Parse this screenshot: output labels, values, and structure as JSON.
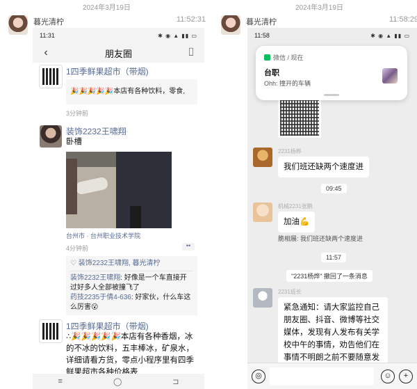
{
  "left": {
    "date": "2024年3月19日",
    "sender": "暮光清柠",
    "time": "11:52:31",
    "status_time": "11:31",
    "status_icons": "✱ ◉ ▲ ▮▮ ▭",
    "nav": {
      "title": "朋友圈",
      "back_icon": "‹",
      "camera_icon": "⌷"
    },
    "posts": [
      {
        "name": "1四季鲜果超市（带烟)",
        "quoted": "🎉🎉🎉🎉🎉本店有各种饮料，零食,",
        "time": "3分钟前"
      },
      {
        "name": "装饰2232王啸翔",
        "text": "卧槽",
        "location": "台州市 · 台州职业技术学院",
        "time": "4分钟前",
        "more": "••",
        "likes": "♡ 装饰2232王啸翔, 暮光清柠",
        "comments": [
          {
            "name": "装饰2232王啸翔",
            "text": ": 好像是一个车直接开过好多人全部被撞飞了"
          },
          {
            "name": "药技2235于倩4-636",
            "text": ": 好家伙，什么车这么厉害😮"
          }
        ]
      },
      {
        "name": "1四季鲜果超市（带烟)",
        "text": "∴🎉🎉🎉🎉🎉本店有各种香烟，冰的不冰的饮料，五丰棒冰，矿泉水，详细请看方货，零点小程序里有四季鲜果超市各种价格表"
      }
    ],
    "home_bar": [
      "≡",
      "◯",
      "⊐"
    ]
  },
  "right": {
    "date": "2024年3月19日",
    "sender": "暮光清柠",
    "time": "11:58:29",
    "status_time": "11:58",
    "status_icons": "✱ ◉ ▲ ▮▮ ▭",
    "notification": {
      "app": "微信 / 现在",
      "title": "台职",
      "body": "Ohh: 撞开的车辆"
    },
    "messages": [
      {
        "sender": "2231杨桦",
        "text": "我们班还缺两个速度进"
      },
      {
        "chip": "09:45"
      },
      {
        "sender": "机械2231张鹏",
        "text": "加油💪"
      },
      {
        "quote": "脆相展: 我们班还缺两个速度进"
      },
      {
        "chip": "11:57"
      },
      {
        "system": "\"2231杨烨\" 撤回了一条消息"
      },
      {
        "sender": "2231班长",
        "text": "紧急通知：请大家监控自己朋友圈、抖音、微博等社交媒体，发现有人发布有关学校中午的事情，劝告他们在事情不明朗之前不要随意发布。@所有人"
      }
    ],
    "input": {
      "voice_icon": "◎",
      "emoji_icon": "☺",
      "plus_icon": "+"
    }
  }
}
